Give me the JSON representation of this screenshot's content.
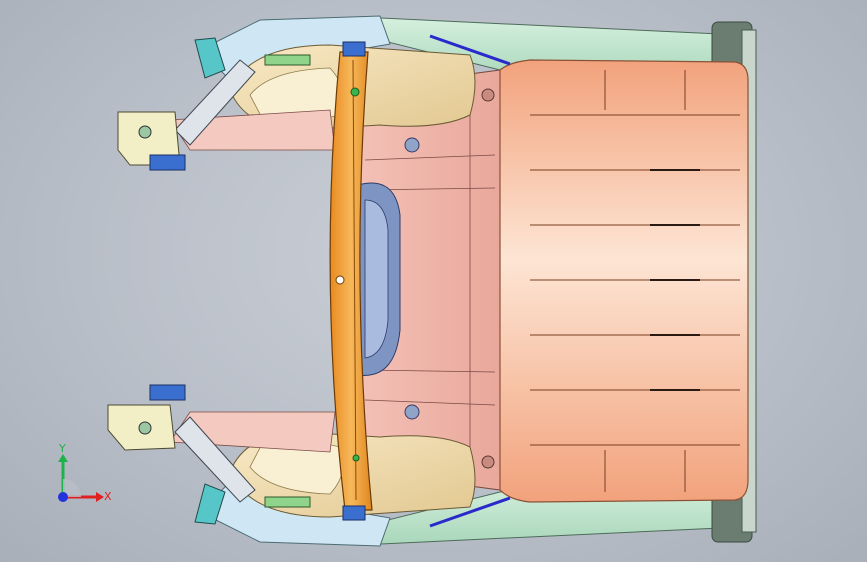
{
  "app": {
    "view": "top"
  },
  "triad": {
    "x_label": "X",
    "y_label": "Y",
    "colors": {
      "x": "#e02020",
      "y": "#1fb24a",
      "z": "#2233dd"
    }
  },
  "model": {
    "parts": [
      "floor-pan",
      "rear-floor-panel",
      "cross-member",
      "left-wheelhouse",
      "right-wheelhouse",
      "left-rail",
      "right-rail",
      "left-bracket",
      "right-bracket",
      "spare-tire-well"
    ],
    "colors": {
      "floor": "#f0b8ad",
      "rear_floor": "#f6b894",
      "cross_member": "#f2a23a",
      "wheelhouse": "#f0dcae",
      "rail": "#bfe7cf",
      "bracket": "#f3efc3",
      "blue_part": "#3a6fd0",
      "well": "#9fb6de"
    }
  }
}
